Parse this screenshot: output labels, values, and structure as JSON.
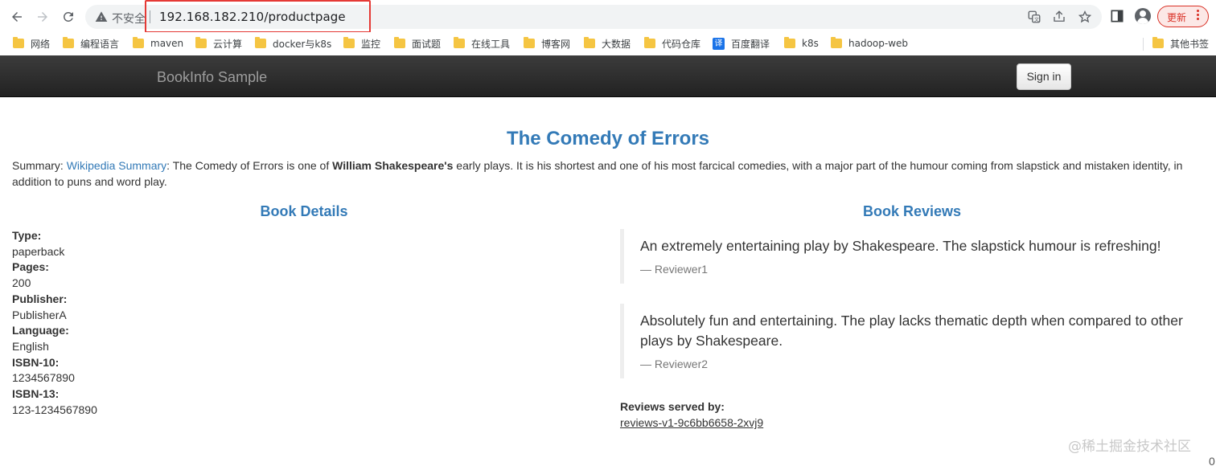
{
  "browser": {
    "insecure_label": "不安全",
    "url": "192.168.182.210/productpage",
    "update_label": "更新",
    "bookmarks": [
      {
        "label": "网络"
      },
      {
        "label": "编程语言"
      },
      {
        "label": "maven"
      },
      {
        "label": "云计算"
      },
      {
        "label": "docker与k8s"
      },
      {
        "label": "监控"
      },
      {
        "label": "面试题"
      },
      {
        "label": "在线工具"
      },
      {
        "label": "博客网"
      },
      {
        "label": "大数据"
      },
      {
        "label": "代码仓库"
      },
      {
        "label": "百度翻译"
      },
      {
        "label": "k8s"
      },
      {
        "label": "hadoop-web"
      },
      {
        "label": "其他书签"
      }
    ],
    "translate_glyph": "译"
  },
  "navbar": {
    "brand": "BookInfo Sample",
    "signin_label": "Sign in"
  },
  "product": {
    "title": "The Comedy of Errors",
    "summary_prefix": "Summary: ",
    "summary_link": "Wikipedia Summary",
    "summary_mid": ": The Comedy of Errors is one of ",
    "summary_bold": "William Shakespeare's",
    "summary_rest": " early plays. It is his shortest and one of his most farcical comedies, with a major part of the humour coming from slapstick and mistaken identity, in addition to puns and word play."
  },
  "details": {
    "heading": "Book Details",
    "type_label": "Type:",
    "type_value": "paperback",
    "pages_label": "Pages:",
    "pages_value": "200",
    "publisher_label": "Publisher:",
    "publisher_value": "PublisherA",
    "language_label": "Language:",
    "language_value": "English",
    "isbn10_label": "ISBN-10:",
    "isbn10_value": "1234567890",
    "isbn13_label": "ISBN-13:",
    "isbn13_value": "123-1234567890"
  },
  "reviews": {
    "heading": "Book Reviews",
    "items": [
      {
        "text": "An extremely entertaining play by Shakespeare. The slapstick humour is refreshing!",
        "reviewer": "— Reviewer1"
      },
      {
        "text": "Absolutely fun and entertaining. The play lacks thematic depth when compared to other plays by Shakespeare.",
        "reviewer": "— Reviewer2"
      }
    ],
    "served_label": "Reviews served by:",
    "served_value": "reviews-v1-9c6bb6658-2xvj9"
  },
  "watermark": "@稀土掘金技术社区",
  "corner_text": "0",
  "colors": {
    "link": "#337ab7",
    "navbar": "#222222",
    "url_highlight": "#e53935",
    "update": "#d93025"
  },
  "icons": [
    "back-icon",
    "forward-icon",
    "reload-icon",
    "warning-icon",
    "translate-icon",
    "share-icon",
    "star-icon",
    "sidepanel-icon",
    "profile-icon",
    "kebab-menu-icon",
    "folder-icon"
  ]
}
